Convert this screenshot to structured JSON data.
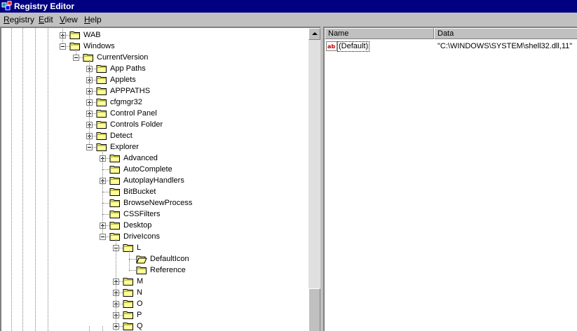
{
  "window": {
    "title": "Registry Editor",
    "icon": "registry-editor-icon"
  },
  "menu": [
    {
      "label": "Registry",
      "accel": "R"
    },
    {
      "label": "Edit",
      "accel": "E"
    },
    {
      "label": "View",
      "accel": "V"
    },
    {
      "label": "Help",
      "accel": "H"
    }
  ],
  "tree": {
    "nodes": [
      {
        "label": "WAB",
        "level": 0,
        "expander": "plus"
      },
      {
        "label": "Windows",
        "level": 0,
        "expander": "minus"
      },
      {
        "label": "CurrentVersion",
        "level": 1,
        "expander": "minus"
      },
      {
        "label": "App Paths",
        "level": 2,
        "expander": "plus"
      },
      {
        "label": "Applets",
        "level": 2,
        "expander": "plus"
      },
      {
        "label": "APPPATHS",
        "level": 2,
        "expander": "plus"
      },
      {
        "label": "cfgmgr32",
        "level": 2,
        "expander": "plus"
      },
      {
        "label": "Control Panel",
        "level": 2,
        "expander": "plus"
      },
      {
        "label": "Controls Folder",
        "level": 2,
        "expander": "plus"
      },
      {
        "label": "Detect",
        "level": 2,
        "expander": "plus"
      },
      {
        "label": "Explorer",
        "level": 2,
        "expander": "minus"
      },
      {
        "label": "Advanced",
        "level": 3,
        "expander": "plus"
      },
      {
        "label": "AutoComplete",
        "level": 3,
        "expander": "none"
      },
      {
        "label": "AutoplayHandlers",
        "level": 3,
        "expander": "plus"
      },
      {
        "label": "BitBucket",
        "level": 3,
        "expander": "none"
      },
      {
        "label": "BrowseNewProcess",
        "level": 3,
        "expander": "none"
      },
      {
        "label": "CSSFilters",
        "level": 3,
        "expander": "none"
      },
      {
        "label": "Desktop",
        "level": 3,
        "expander": "plus"
      },
      {
        "label": "DriveIcons",
        "level": 3,
        "expander": "minus"
      },
      {
        "label": "L",
        "level": 4,
        "expander": "minus"
      },
      {
        "label": "DefaultIcon",
        "level": 5,
        "expander": "none",
        "open": true
      },
      {
        "label": "Reference",
        "level": 5,
        "expander": "none"
      },
      {
        "label": "M",
        "level": 4,
        "expander": "plus"
      },
      {
        "label": "N",
        "level": 4,
        "expander": "plus"
      },
      {
        "label": "O",
        "level": 4,
        "expander": "plus"
      },
      {
        "label": "P",
        "level": 4,
        "expander": "plus"
      },
      {
        "label": "Q",
        "level": 4,
        "expander": "plus"
      }
    ]
  },
  "list": {
    "columns": [
      {
        "label": "Name"
      },
      {
        "label": "Data"
      }
    ],
    "rows": [
      {
        "name": "(Default)",
        "data": "\"C:\\WINDOWS\\SYSTEM\\shell32.dll,11\"",
        "icon": "string-value-icon"
      }
    ]
  },
  "colors": {
    "titlebar": "#000080",
    "window": "#c0c0c0",
    "folder": "#ffff99"
  }
}
